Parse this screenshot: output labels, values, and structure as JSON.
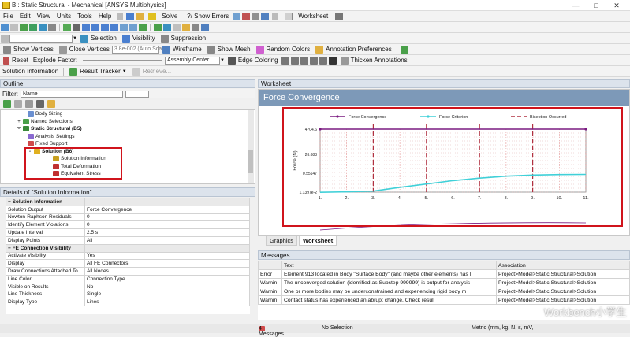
{
  "window": {
    "title": "B : Static Structural - Mechanical [ANSYS Multiphysics]",
    "controls": [
      "—",
      "□",
      "✕"
    ]
  },
  "menu": [
    "File",
    "Edit",
    "View",
    "Units",
    "Tools",
    "Help"
  ],
  "toolbar1": {
    "solve": "Solve",
    "show_errors": "?/ Show Errors",
    "worksheet": "Worksheet"
  },
  "toolbar2": {
    "selection": "Selection",
    "visibility": "Visibility",
    "suppression": "Suppression"
  },
  "toolbar3": {
    "show_vertices": "Show Vertices",
    "close_vertices": "Close Vertices",
    "auto_scale": "3.8e-002 (Auto Scale)",
    "wireframe": "Wireframe",
    "show_mesh": "Show Mesh",
    "random_colors": "Random Colors",
    "annotation_prefs": "Annotation Preferences"
  },
  "toolbar4": {
    "reset": "Reset",
    "explode_factor": "Explode Factor:",
    "assembly_center": "Assembly Center",
    "edge_coloring": "Edge Coloring",
    "thicken_annotations": "Thicken Annotations"
  },
  "toolbar5": {
    "solution_information": "Solution Information",
    "result_tracker": "Result Tracker",
    "retrieve": "Retrieve..."
  },
  "outline": {
    "header": "Outline",
    "filter_label": "Filter:",
    "filter_value": "Name",
    "nodes": [
      {
        "label": "Body Sizing",
        "color": "#6a8fd0"
      },
      {
        "label": "Named Selections",
        "color": "#4aa04a"
      },
      {
        "label": "Static Structural (B5)",
        "color": "#3a8a3a"
      },
      {
        "label": "Analysis Settings",
        "color": "#8a6ad0"
      },
      {
        "label": "Fixed Support",
        "color": "#d04a4a"
      },
      {
        "label": "Solution (B6)",
        "color": "#e0b020"
      },
      {
        "label": "Solution Information",
        "color": "#c8a020"
      },
      {
        "label": "Total Deformation",
        "color": "#c03030"
      },
      {
        "label": "Equivalent Stress",
        "color": "#c03030"
      }
    ]
  },
  "details": {
    "header": "Details of \"Solution Information\"",
    "rows": [
      {
        "k": "Solution Information",
        "v": "",
        "group": true
      },
      {
        "k": "Solution Output",
        "v": "Force Convergence"
      },
      {
        "k": "Newton-Raphson Residuals",
        "v": "0"
      },
      {
        "k": "Identify Element Violations",
        "v": "0"
      },
      {
        "k": "Update Interval",
        "v": "2.5 s"
      },
      {
        "k": "Display Points",
        "v": "All"
      },
      {
        "k": "FE Connection Visibility",
        "v": "",
        "group": true
      },
      {
        "k": "Activate Visibility",
        "v": "Yes"
      },
      {
        "k": "Display",
        "v": "All FE Connectors"
      },
      {
        "k": "Draw Connections Attached To",
        "v": "All Nodes"
      },
      {
        "k": "Line Color",
        "v": "Connection Type"
      },
      {
        "k": "Visible on Results",
        "v": "No"
      },
      {
        "k": "Line Thickness",
        "v": "Single"
      },
      {
        "k": "Display Type",
        "v": "Lines"
      }
    ]
  },
  "worksheet": {
    "header": "Worksheet",
    "title": "Force Convergence",
    "tabs": [
      "Graphics",
      "Worksheet"
    ]
  },
  "chart_data": {
    "type": "line",
    "title": "",
    "ylabel": "Force (N)",
    "yticks": [
      "4704.6",
      "26.683",
      "0.55147",
      "1.1397e-2"
    ],
    "xticks": [
      "1.",
      "2.",
      "3.",
      "4.",
      "5.",
      "6.",
      "7.",
      "8.",
      "9.",
      "10.",
      "11."
    ],
    "legend": [
      "Force Convergence",
      "Force Criterion",
      "Bisection Occurred"
    ],
    "legend_position": "top",
    "series": [
      {
        "name": "Force Convergence",
        "color": "#7a1a80",
        "x": [
          1,
          11
        ],
        "y": [
          4704.6,
          4704.6
        ]
      },
      {
        "name": "Force Criterion",
        "color": "#40d0d8",
        "x": [
          1,
          2,
          3,
          4,
          5,
          6,
          7,
          8,
          9,
          10,
          11
        ],
        "y": [
          0.011,
          0.012,
          0.014,
          0.03,
          0.06,
          0.12,
          0.2,
          0.3,
          0.38,
          0.42,
          0.43
        ]
      }
    ],
    "bisections": [
      3,
      5,
      7,
      9
    ]
  },
  "messages": {
    "header": "Messages",
    "cols": [
      "",
      "Text",
      "Association"
    ],
    "rows": [
      {
        "type": "Error",
        "text": "Element 913 located in Body \"Surface Body\" (and maybe other elements) has l",
        "assoc": "Project>Model>Static Structural>Solution"
      },
      {
        "type": "Warnin",
        "text": "The unconverged solution (identified as Substep 999999) is output for analysis",
        "assoc": "Project>Model>Static Structural>Solution"
      },
      {
        "type": "Warnin",
        "text": "One or more bodies may be underconstrained and experiencing rigid body m",
        "assoc": "Project>Model>Static Structural>Solution"
      },
      {
        "type": "Warnin",
        "text": "Contact status has experienced an abrupt change.  Check resul",
        "assoc": "Project>Model>Static Structural>Solution"
      }
    ]
  },
  "status": {
    "messages": "4 Messages",
    "selection": "No Selection",
    "units": "Metric (mm, kg, N, s, mV,",
    "watermark": "Workbench小学生"
  }
}
